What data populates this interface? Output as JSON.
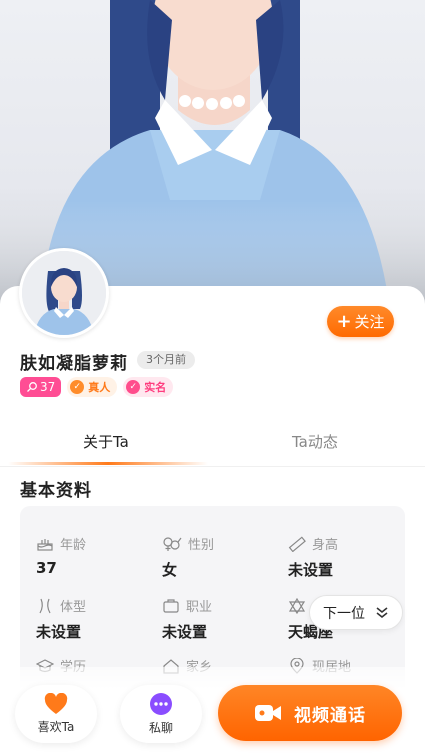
{
  "profile": {
    "name": "肤如凝脂萝莉",
    "last_active": "3个月前",
    "age_tag": "37",
    "real_person_tag": "真人",
    "real_name_tag": "实名",
    "follow_label": "关注",
    "follow_symbol": "+"
  },
  "tabs": [
    {
      "label": "关于Ta",
      "active": true
    },
    {
      "label": "Ta动态",
      "active": false
    }
  ],
  "basic_info": {
    "title": "基本资料",
    "items": [
      {
        "label": "年龄",
        "value": "37",
        "icon": "cake-icon"
      },
      {
        "label": "性别",
        "value": "女",
        "icon": "gender-icon"
      },
      {
        "label": "身高",
        "value": "未设置",
        "icon": "ruler-icon"
      },
      {
        "label": "体型",
        "value": "未设置",
        "icon": "body-shape-icon"
      },
      {
        "label": "职业",
        "value": "未设置",
        "icon": "briefcase-icon"
      },
      {
        "label": "星座",
        "value": "天蝎座",
        "icon": "star-icon"
      },
      {
        "label": "学历",
        "value": "",
        "icon": "graduation-icon"
      },
      {
        "label": "家乡",
        "value": "",
        "icon": "home-icon"
      },
      {
        "label": "现居地",
        "value": "",
        "icon": "location-icon"
      }
    ]
  },
  "next_button": {
    "label": "下一位"
  },
  "bottom_bar": {
    "like_label": "喜欢Ta",
    "chat_label": "私聊",
    "video_label": "视频通话"
  },
  "colors": {
    "accent_orange": "#ff6a00",
    "like_orange": "#ff7a1a",
    "chat_purple": "#8a4dff",
    "age_pink": "#ff4d94"
  }
}
